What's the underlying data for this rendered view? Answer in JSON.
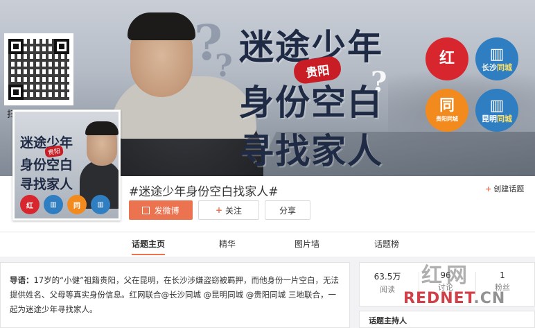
{
  "banner": {
    "scan_text": "扫码关注寻人",
    "title_line1": "迷途少年",
    "title_line2": "身份空白",
    "title_line3": "寻找家人",
    "tag": "贵阳",
    "logos": [
      {
        "icon": "hongwang-logo-icon",
        "glyph": "红",
        "caption": "",
        "color": "#d8262f"
      },
      {
        "icon": "city-building-icon",
        "glyph": "▥",
        "caption_a": "长沙",
        "caption_b": "同城",
        "color": "#2f7ec1"
      },
      {
        "icon": "tong-logo-icon",
        "glyph": "同",
        "caption_a": "贵阳",
        "caption_b": "同城",
        "color": "#f28a1e"
      },
      {
        "icon": "city-building-icon",
        "glyph": "▥",
        "caption_a": "昆明",
        "caption_b": "同城",
        "color": "#2f7ec1"
      }
    ]
  },
  "thumbnail": {
    "line1": "迷途少年",
    "line2": "身份空白",
    "line3": "寻找家人",
    "tag": "贵阳"
  },
  "header": {
    "topic_title": "#迷途少年身份空白找家人#",
    "create_topic": "创建话题",
    "post_button": "发微博",
    "follow_button": "关注",
    "share_button": "分享"
  },
  "tabs": [
    {
      "label": "话题主页",
      "active": true
    },
    {
      "label": "精华",
      "active": false
    },
    {
      "label": "图片墙",
      "active": false
    },
    {
      "label": "话题榜",
      "active": false
    }
  ],
  "intro": {
    "lead": "导语：",
    "text": "17岁的“小健”祖籍贵阳，父在昆明，在长沙涉嫌盗窃被羁押，而他身份一片空白，无法提供姓名、父母等真实身份信息。红网联合@长沙同城 @昆明同城 @贵阳同城 三地联合，一起为迷途少年寻找家人。"
  },
  "stats": [
    {
      "value": "63.5万",
      "label": "阅读"
    },
    {
      "value": "96",
      "label": "讨论"
    },
    {
      "value": "1",
      "label": "粉丝"
    }
  ],
  "host": {
    "title": "话题主持人"
  },
  "watermark": {
    "top": "红网",
    "bottom_red": "REDNET",
    "bottom_gray": ".CN"
  },
  "colors": {
    "accent": "#eb7350",
    "brand_red": "#d8262f",
    "brand_blue": "#2f7ec1",
    "title_navy": "#1f2a44"
  }
}
